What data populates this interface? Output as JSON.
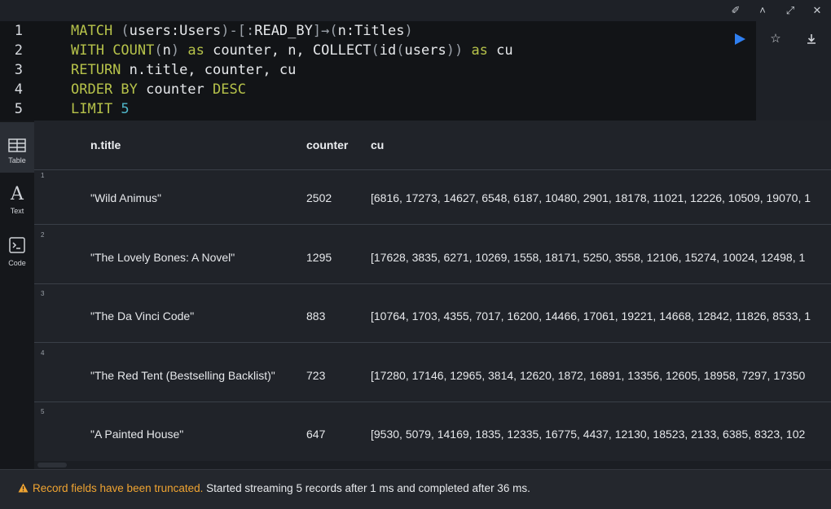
{
  "window": {
    "controls": [
      {
        "name": "pin-icon",
        "glyph": "✐"
      },
      {
        "name": "collapse-icon",
        "glyph": "˄"
      },
      {
        "name": "expand-icon",
        "glyph": "⤢"
      },
      {
        "name": "close-icon",
        "glyph": "✕"
      }
    ]
  },
  "editor": {
    "line_numbers": [
      "1",
      "2",
      "3",
      "4",
      "5"
    ],
    "lines": [
      [
        [
          "kw",
          "MATCH "
        ],
        [
          "pu",
          "("
        ],
        [
          "id",
          "users:Users"
        ],
        [
          "pu",
          ")-[:"
        ],
        [
          "id",
          "READ_BY"
        ],
        [
          "pu",
          "]→("
        ],
        [
          "id",
          "n:Titles"
        ],
        [
          "pu",
          ")"
        ]
      ],
      [
        [
          "kw",
          "WITH "
        ],
        [
          "fn",
          "COUNT"
        ],
        [
          "pu",
          "("
        ],
        [
          "id",
          "n"
        ],
        [
          "pu",
          ")"
        ],
        [
          "kw",
          " as "
        ],
        [
          "id",
          "counter, n, COLLECT"
        ],
        [
          "pu",
          "("
        ],
        [
          "id",
          "id"
        ],
        [
          "pu",
          "("
        ],
        [
          "id",
          "users"
        ],
        [
          "pu",
          "))"
        ],
        [
          "kw",
          " as "
        ],
        [
          "id",
          "cu"
        ]
      ],
      [
        [
          "kw",
          "RETURN "
        ],
        [
          "id",
          "n.title, counter, cu"
        ]
      ],
      [
        [
          "kw",
          "ORDER BY "
        ],
        [
          "id",
          "counter "
        ],
        [
          "kw",
          "DESC"
        ]
      ],
      [
        [
          "kw",
          "LIMIT "
        ],
        [
          "num",
          "5"
        ]
      ]
    ],
    "accent_color": "#2f7ff0"
  },
  "sidenav": {
    "items": [
      {
        "label": "Table",
        "icon": "table-icon",
        "active": true
      },
      {
        "label": "Text",
        "icon": "text-icon",
        "active": false
      },
      {
        "label": "Code",
        "icon": "code-icon",
        "active": false
      }
    ]
  },
  "table": {
    "headers": [
      "n.title",
      "counter",
      "cu"
    ],
    "rows": [
      {
        "index": "1",
        "title": "\"Wild Animus\"",
        "counter": "2502",
        "cu": "[6816, 17273, 14627, 6548, 6187, 10480, 2901, 18178, 11021, 12226, 10509, 19070, 1"
      },
      {
        "index": "2",
        "title": "\"The Lovely Bones: A Novel\"",
        "counter": "1295",
        "cu": "[17628, 3835, 6271, 10269, 1558, 18171, 5250, 3558, 12106, 15274, 10024, 12498, 1"
      },
      {
        "index": "3",
        "title": "\"The Da Vinci Code\"",
        "counter": "883",
        "cu": "[10764, 1703, 4355, 7017, 16200, 14466, 17061, 19221, 14668, 12842, 11826, 8533, 1"
      },
      {
        "index": "4",
        "title": "\"The Red Tent (Bestselling Backlist)\"",
        "counter": "723",
        "cu": "[17280, 17146, 12965, 3814, 12620, 1872, 16891, 13356, 12605, 18958, 7297, 17350"
      },
      {
        "index": "5",
        "title": "\"A Painted House\"",
        "counter": "647",
        "cu": "[9530, 5079, 14169, 1835, 12335, 16775, 4437, 12130, 18523, 2133, 6385, 8323, 102"
      }
    ]
  },
  "footer": {
    "warning": "Record fields have been truncated.",
    "info": " Started streaming 5 records after 1 ms and completed after 36 ms.",
    "warning_color": "#f0a431"
  }
}
